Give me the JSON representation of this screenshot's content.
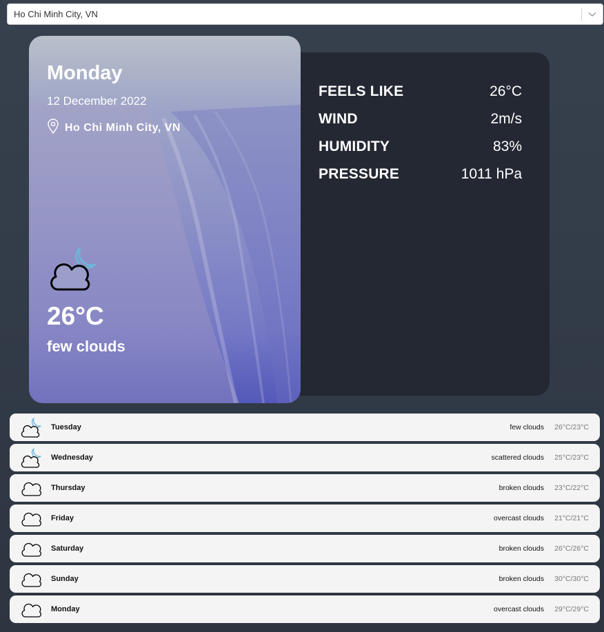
{
  "search": {
    "selected": "Ho Chi Minh City, VN",
    "icon": "chevron-down-icon"
  },
  "current": {
    "day": "Monday",
    "date": "12 December 2022",
    "location": "Ho Chi Minh City, VN",
    "location_icon": "location-pin-icon",
    "weather_icon": "cloud-moon-icon",
    "temperature": "26°C",
    "description": "few clouds"
  },
  "details": [
    {
      "label": "FEELS LIKE",
      "value": "26°C"
    },
    {
      "label": "WIND",
      "value": "2m/s"
    },
    {
      "label": "HUMIDITY",
      "value": "83%"
    },
    {
      "label": "PRESSURE",
      "value": "1011 hPa"
    }
  ],
  "forecast": [
    {
      "day": "Tuesday",
      "description": "few clouds",
      "temps": "26°C/23°C",
      "icon": "cloud-moon-icon"
    },
    {
      "day": "Wednesday",
      "description": "scattered clouds",
      "temps": "25°C/23°C",
      "icon": "cloud-moon-icon"
    },
    {
      "day": "Thursday",
      "description": "broken clouds",
      "temps": "23°C/22°C",
      "icon": "cloud-icon"
    },
    {
      "day": "Friday",
      "description": "overcast clouds",
      "temps": "21°C/21°C",
      "icon": "cloud-icon"
    },
    {
      "day": "Saturday",
      "description": "broken clouds",
      "temps": "26°C/26°C",
      "icon": "cloud-icon"
    },
    {
      "day": "Sunday",
      "description": "broken clouds",
      "temps": "30°C/30°C",
      "icon": "cloud-icon"
    },
    {
      "day": "Monday",
      "description": "overcast clouds",
      "temps": "29°C/29°C",
      "icon": "cloud-icon"
    }
  ],
  "colors": {
    "moon": "#6db4d8",
    "card_panel": "#232833",
    "forecast_bg": "#f4f4f4"
  }
}
